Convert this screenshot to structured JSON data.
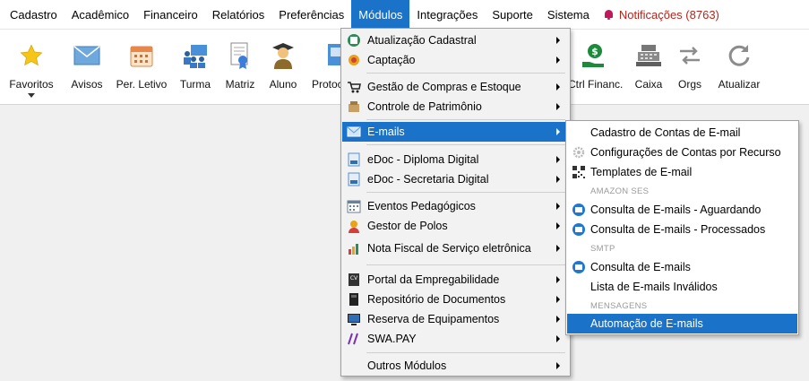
{
  "menubar": {
    "items": [
      {
        "label": "Cadastro"
      },
      {
        "label": "Acadêmico"
      },
      {
        "label": "Financeiro"
      },
      {
        "label": "Relatórios"
      },
      {
        "label": "Preferências"
      },
      {
        "label": "Módulos"
      },
      {
        "label": "Integrações"
      },
      {
        "label": "Suporte"
      },
      {
        "label": "Sistema"
      }
    ],
    "notifications": "Notificações (8763)"
  },
  "toolbar": {
    "items": [
      {
        "label": "Favoritos",
        "icon": "star-icon"
      },
      {
        "label": "Avisos",
        "icon": "envelope-icon"
      },
      {
        "label": "Per. Letivo",
        "icon": "calendar-icon"
      },
      {
        "label": "Turma",
        "icon": "class-icon"
      },
      {
        "label": "Matriz",
        "icon": "certificate-icon"
      },
      {
        "label": "Aluno",
        "icon": "student-icon"
      },
      {
        "label": "Protoc",
        "icon": "protocol-icon"
      },
      {
        "label": "Ctrl Financ.",
        "icon": "money-hand-icon"
      },
      {
        "label": "Caixa",
        "icon": "cash-register-icon"
      },
      {
        "label": "Orgs",
        "icon": "swap-arrows-icon"
      },
      {
        "label": "Atualizar",
        "icon": "refresh-icon"
      }
    ]
  },
  "modulos_menu": {
    "items": [
      {
        "label": "Atualização Cadastral",
        "icon": "update-icon"
      },
      {
        "label": "Captação",
        "icon": "capture-icon"
      },
      {
        "label": "Gestão de Compras e Estoque",
        "icon": "cart-icon"
      },
      {
        "label": "Controle de Patrimônio",
        "icon": "box-icon"
      },
      {
        "label": "E-mails",
        "icon": "email-icon"
      },
      {
        "label": "eDoc - Diploma Digital",
        "icon": "doc-icon"
      },
      {
        "label": "eDoc - Secretaria Digital",
        "icon": "doc-icon"
      },
      {
        "label": "Eventos Pedagógicos",
        "icon": "calendar-icon"
      },
      {
        "label": "Gestor de Polos",
        "icon": "person-icon"
      },
      {
        "label": "Nota Fiscal de Serviço eletrônica",
        "icon": "chart-icon"
      },
      {
        "label": "Portal da Empregabilidade",
        "icon": "cv-icon"
      },
      {
        "label": "Repositório de Documentos",
        "icon": "book-icon"
      },
      {
        "label": "Reserva de Equipamentos",
        "icon": "monitor-icon"
      },
      {
        "label": "SWA.PAY",
        "icon": "slash-icon"
      },
      {
        "label": "Outros Módulos",
        "icon": ""
      }
    ]
  },
  "emails_submenu": {
    "items": [
      {
        "label": "Cadastro de Contas de E-mail"
      },
      {
        "label": "Configurações de Contas por Recurso"
      },
      {
        "label": "Templates de E-mail"
      },
      {
        "label": "Consulta de E-mails - Aguardando"
      },
      {
        "label": "Consulta de E-mails - Processados"
      },
      {
        "label": "Consulta de E-mails"
      },
      {
        "label": "Lista de E-mails Inválidos"
      },
      {
        "label": "Automação de E-mails"
      }
    ],
    "headers": [
      "AMAZON SES",
      "SMTP",
      "MENSAGENS"
    ]
  },
  "colors": {
    "accent": "#1a73c8",
    "notification": "#b3261e"
  }
}
